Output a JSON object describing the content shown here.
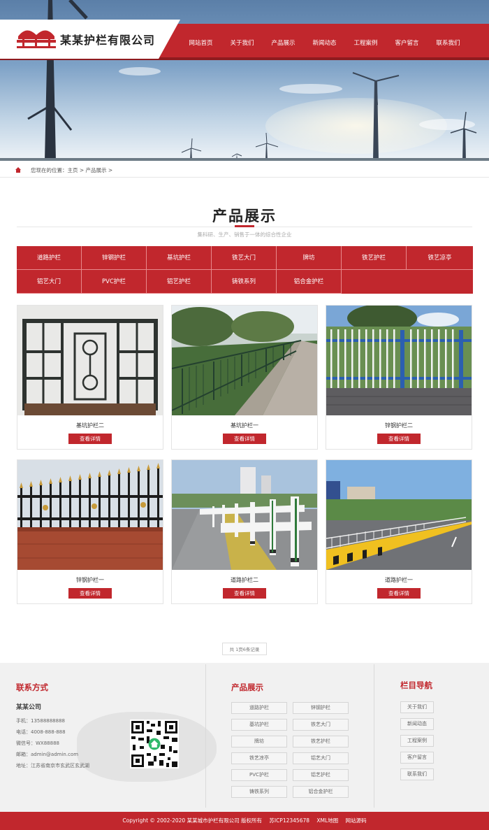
{
  "brand": {
    "name": "某某护栏有限公司",
    "red": "#c1272d"
  },
  "nav": [
    "网站首页",
    "关于我们",
    "产品展示",
    "新闻动态",
    "工程案例",
    "客户留言",
    "联系我们"
  ],
  "breadcrumb": {
    "icon": "home-icon",
    "text": "您现在的位置：主页 > 产品展示 >"
  },
  "section": {
    "title": "产品展示",
    "subtitle": "集科研、生产、销售于一体的综合性企业"
  },
  "categories": [
    "道路护栏",
    "锌钢护栏",
    "基坑护栏",
    "铁艺大门",
    "牌坊",
    "铁艺护栏",
    "铁艺凉亭",
    "铝艺大门",
    "PVC护栏",
    "铝艺护栏",
    "铸铁系列",
    "铝合金护栏"
  ],
  "products": [
    {
      "name": "基坑护栏二",
      "button": "查看详情"
    },
    {
      "name": "基坑护栏一",
      "button": "查看详情"
    },
    {
      "name": "锌钢护栏二",
      "button": "查看详情"
    },
    {
      "name": "锌钢护栏一",
      "button": "查看详情"
    },
    {
      "name": "道路护栏二",
      "button": "查看详情"
    },
    {
      "name": "道路护栏一",
      "button": "查看详情"
    }
  ],
  "pager": "共 1页6条记录",
  "footer": {
    "contact": {
      "title": "联系方式",
      "company": "某某公司",
      "phone": "手机：13588888888",
      "tel": "电话：4008-888-888",
      "wechat": "微信号：WX88888",
      "email": "邮箱：admin@admin.com",
      "address": "地址：江苏省南京市玄武区玄武湖"
    },
    "products_title": "产品展示",
    "product_links": [
      "道路护栏",
      "锌钢护栏",
      "基坑护栏",
      "铁艺大门",
      "牌坊",
      "铁艺护栏",
      "铁艺凉亭",
      "铝艺大门",
      "PVC护栏",
      "铝艺护栏",
      "铸铁系列",
      "铝合金护栏"
    ],
    "nav_title": "栏目导航",
    "nav_links": [
      "关于我们",
      "新闻动态",
      "工程案例",
      "客户留言",
      "联系我们"
    ]
  },
  "copyright": {
    "text": "Copyright © 2002-2020 某某城市护栏有限公司 版权所有",
    "icp": "苏ICP12345678",
    "xml": "XML地图",
    "source": "网站源码"
  }
}
